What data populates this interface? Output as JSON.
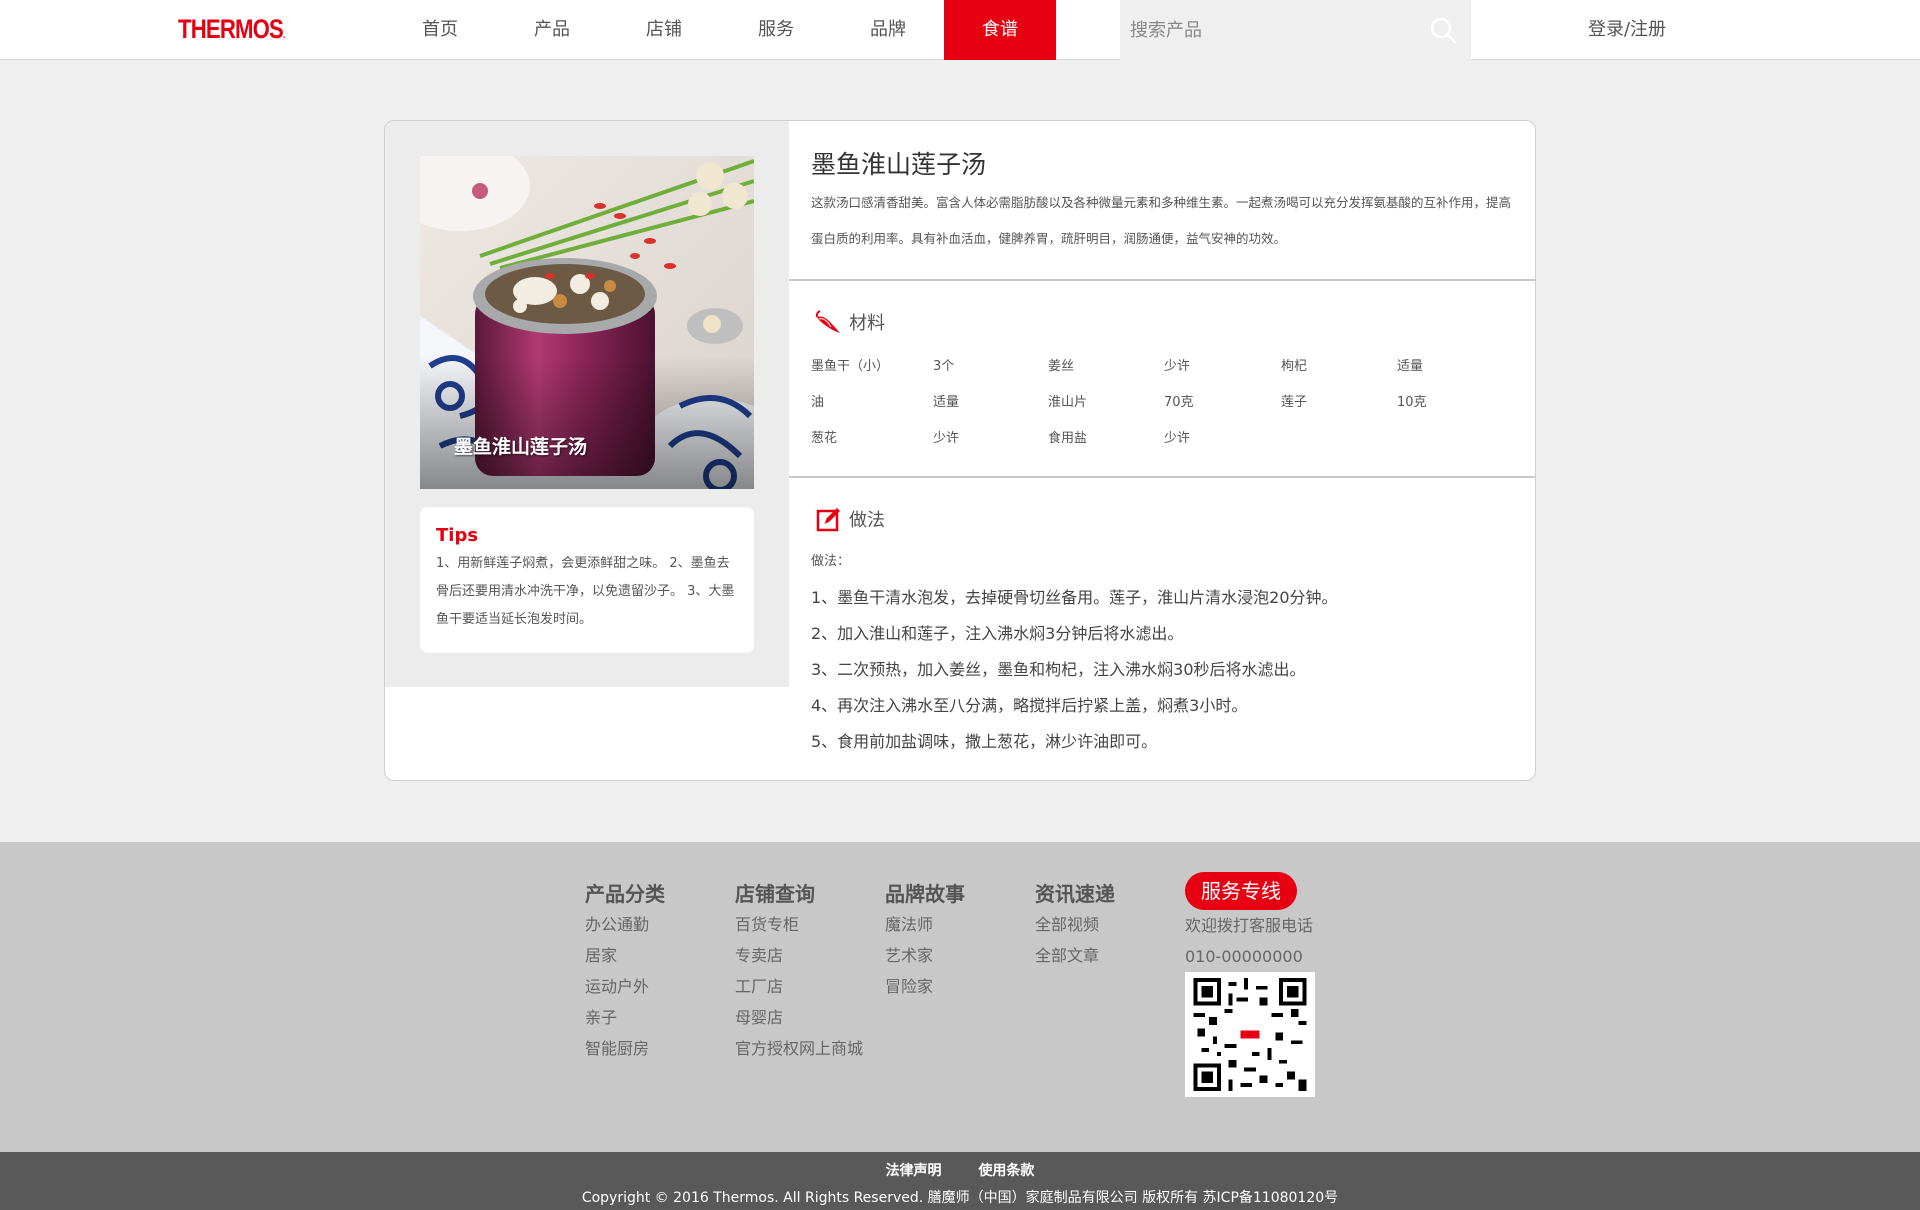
{
  "header": {
    "logo": "THERMOS",
    "logo_mark": ".",
    "nav": [
      {
        "label": "首页"
      },
      {
        "label": "产品"
      },
      {
        "label": "店铺"
      },
      {
        "label": "服务"
      },
      {
        "label": "品牌"
      },
      {
        "label": "食谱",
        "active": true
      }
    ],
    "search": {
      "placeholder": "搜索产品",
      "icon": "search-icon"
    },
    "login": "登录/注册"
  },
  "recipe": {
    "photo_caption": "墨鱼淮山莲子汤",
    "tips": {
      "title": "Tips",
      "text": "1、用新鲜莲子焖煮，会更添鲜甜之味。 2、墨鱼去骨后还要用清水冲洗干净，以免遗留沙子。 3、大墨鱼干要适当延长泡发时间。"
    },
    "title": "墨鱼淮山莲子汤",
    "description": "这款汤口感清香甜美。富含人体必需脂肪酸以及各种微量元素和多种维生素。一起煮汤喝可以充分发挥氨基酸的互补作用，提高蛋白质的利用率。具有补血活血，健脾养胃，疏肝明目，润肠通便，益气安神的功效。",
    "ingredients_heading": "材料",
    "ingredients": [
      {
        "name": "墨鱼干（小）",
        "amount": "3个"
      },
      {
        "name": "姜丝",
        "amount": "少许"
      },
      {
        "name": "枸杞",
        "amount": "适量"
      },
      {
        "name": "油",
        "amount": "适量"
      },
      {
        "name": "淮山片",
        "amount": "70克"
      },
      {
        "name": "莲子",
        "amount": "10克"
      },
      {
        "name": "葱花",
        "amount": "少许"
      },
      {
        "name": "食用盐",
        "amount": "少许"
      }
    ],
    "method_heading": "做法",
    "method_label": "做法：",
    "steps": [
      "1、墨鱼干清水泡发，去掉硬骨切丝备用。莲子，淮山片清水浸泡20分钟。",
      "2、加入淮山和莲子，注入沸水焖3分钟后将水滤出。",
      "3、二次预热，加入姜丝，墨鱼和枸杞，注入沸水焖30秒后将水滤出。",
      "4、再次注入沸水至八分满，略搅拌后拧紧上盖，焖煮3小时。",
      "5、食用前加盐调味，撒上葱花，淋少许油即可。"
    ]
  },
  "footer": {
    "columns": [
      {
        "title": "产品分类",
        "links": [
          "办公通勤",
          "居家",
          "运动户外",
          "亲子",
          "智能厨房"
        ]
      },
      {
        "title": "店铺查询",
        "links": [
          "百货专柜",
          "专卖店",
          "工厂店",
          "母婴店",
          "官方授权网上商城"
        ]
      },
      {
        "title": "品牌故事",
        "links": [
          "魔法师",
          "艺术家",
          "冒险家"
        ]
      },
      {
        "title": "资讯速递",
        "links": [
          "全部视频",
          "全部文章"
        ]
      }
    ],
    "service": {
      "title": "服务专线",
      "line1": "欢迎拨打客服电话",
      "phone": "010-00000000"
    },
    "legal_links": [
      "法律声明",
      "使用条款"
    ],
    "copyright": "Copyright © 2016 Thermos. All Rights Reserved. 膳魔师（中国）家庭制品有限公司 版权所有 苏ICP备11080120号"
  },
  "colors": {
    "brand_red": "#e60012",
    "footer_bg": "#c8c8c8",
    "bottom_bar": "#595959"
  }
}
